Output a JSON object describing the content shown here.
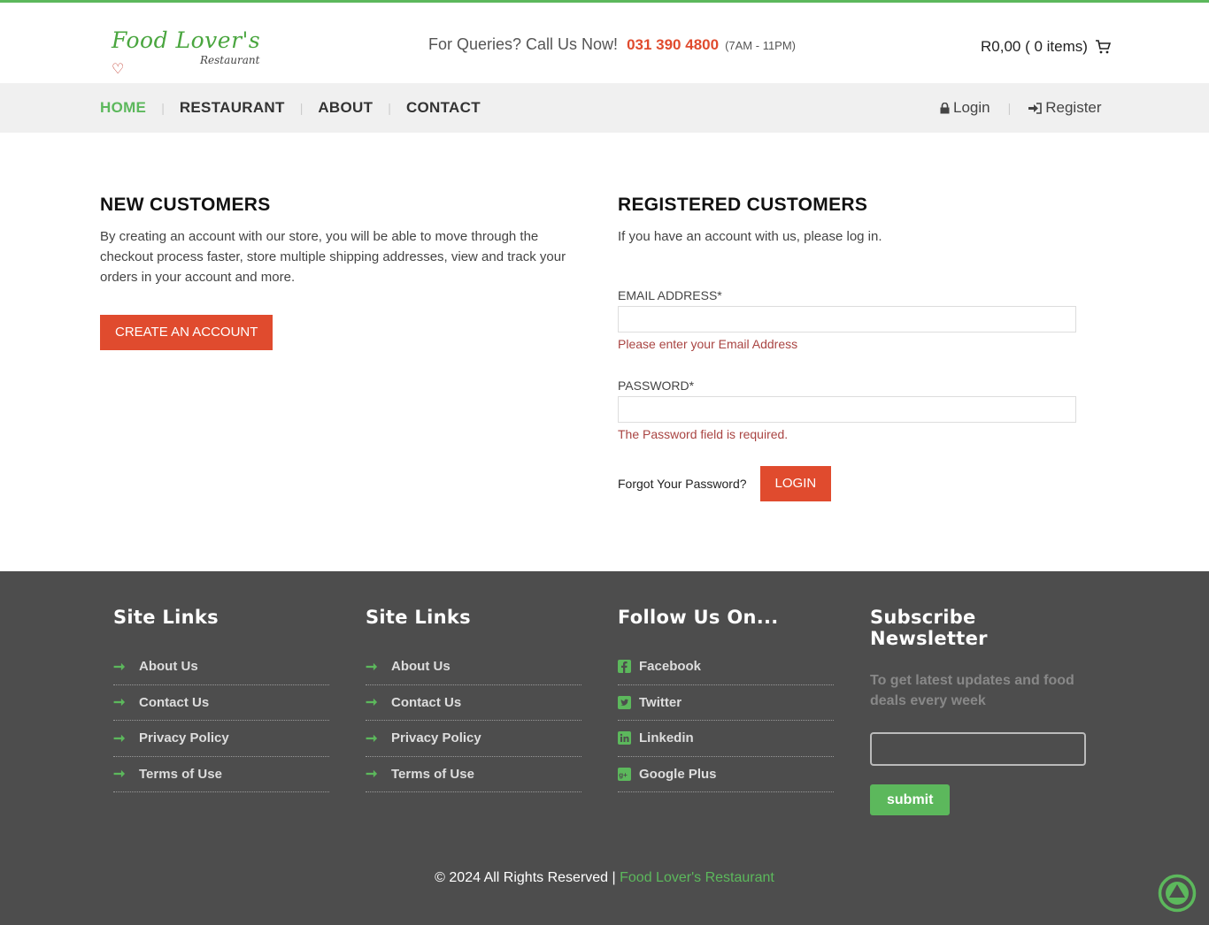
{
  "header": {
    "logo_top": "Food Lover's",
    "logo_bottom": "Restaurant",
    "queries_label": "For Queries? Call Us Now!",
    "phone": "031 390 4800",
    "hours": "(7AM - 11PM)",
    "cart_text": "R0,00 ( 0 items)"
  },
  "nav": {
    "items": [
      "HOME",
      "RESTAURANT",
      "ABOUT",
      "CONTACT"
    ],
    "login": "Login",
    "register": "Register"
  },
  "new_customers": {
    "title": "NEW CUSTOMERS",
    "description": "By creating an account with our store, you will be able to move through the checkout process faster, store multiple shipping addresses, view and track your orders in your account and more.",
    "button": "CREATE AN ACCOUNT"
  },
  "registered": {
    "title": "REGISTERED CUSTOMERS",
    "description": "If you have an account with us, please log in.",
    "email_label": "EMAIL ADDRESS*",
    "email_value": "",
    "email_error": "Please enter your Email Address",
    "password_label": "PASSWORD*",
    "password_value": "",
    "password_error": "The Password field is required.",
    "forgot": "Forgot Your Password?",
    "login_button": "LOGIN"
  },
  "footer": {
    "col1": {
      "title": "Site Links",
      "links": [
        "About Us",
        "Contact Us",
        "Privacy Policy",
        "Terms of Use"
      ]
    },
    "col2": {
      "title": "Site Links",
      "links": [
        "About Us",
        "Contact Us",
        "Privacy Policy",
        "Terms of Use"
      ]
    },
    "col3": {
      "title": "Follow Us On...",
      "links": [
        "Facebook",
        "Twitter",
        "Linkedin",
        "Google Plus"
      ],
      "icons": [
        "facebook-icon",
        "twitter-icon",
        "linkedin-icon",
        "google-plus-icon"
      ]
    },
    "col4": {
      "title": "Subscribe Newsletter",
      "text": "To get latest updates and food deals every week",
      "input_value": "",
      "button": "submit"
    },
    "copyright": "© 2024 All Rights Reserved |",
    "brand": "Food Lover's Restaurant"
  },
  "colors": {
    "accent_green": "#5cb85c",
    "accent_red": "#e04b2e",
    "footer_bg": "#4d4d4d"
  }
}
